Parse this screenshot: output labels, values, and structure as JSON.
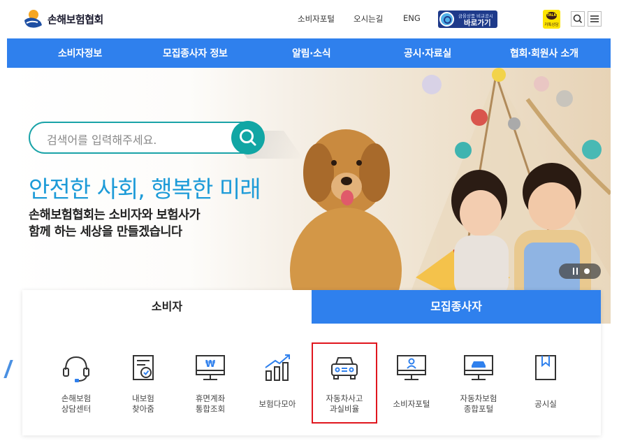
{
  "header": {
    "logo_text": "손해보험협회",
    "links": [
      "소비자포털",
      "오시는길",
      "ENG"
    ],
    "compare_small": "금융상품 비교공시",
    "compare_big": "바로가기",
    "talk_bubble": "TALK",
    "talk_label": "카톡상담"
  },
  "nav": {
    "items": [
      "소비자정보",
      "모집종사자 정보",
      "알림·소식",
      "공시·자료실",
      "협회·회원사 소개"
    ]
  },
  "hero": {
    "search_placeholder": "검색어를 입력해주세요.",
    "title": "안전한 사회, 행복한 미래",
    "subtitle_line1": "손해보험협회는 소비자와 보험사가",
    "subtitle_line2": "함께 하는 세상을 만들겠습니다"
  },
  "quick": {
    "tabs": [
      "소비자",
      "모집종사자"
    ],
    "items": [
      {
        "label": "손해보험\n상담센터",
        "icon": "headset-icon"
      },
      {
        "label": "내보험\n찾아줌",
        "icon": "document-search-icon"
      },
      {
        "label": "휴면계좌\n통합조회",
        "icon": "monitor-won-icon"
      },
      {
        "label": "보험다모아",
        "icon": "bar-chart-icon"
      },
      {
        "label": "자동차사고\n과실비율",
        "icon": "car-icon"
      },
      {
        "label": "소비자포털",
        "icon": "monitor-user-icon"
      },
      {
        "label": "자동차보험\n종합포털",
        "icon": "monitor-car-icon"
      },
      {
        "label": "공시실",
        "icon": "book-icon"
      }
    ]
  },
  "colors": {
    "nav_blue": "#2f80ed",
    "teal": "#11a6a4",
    "title_blue": "#1d9bd8",
    "highlight_red": "#e0161e"
  }
}
